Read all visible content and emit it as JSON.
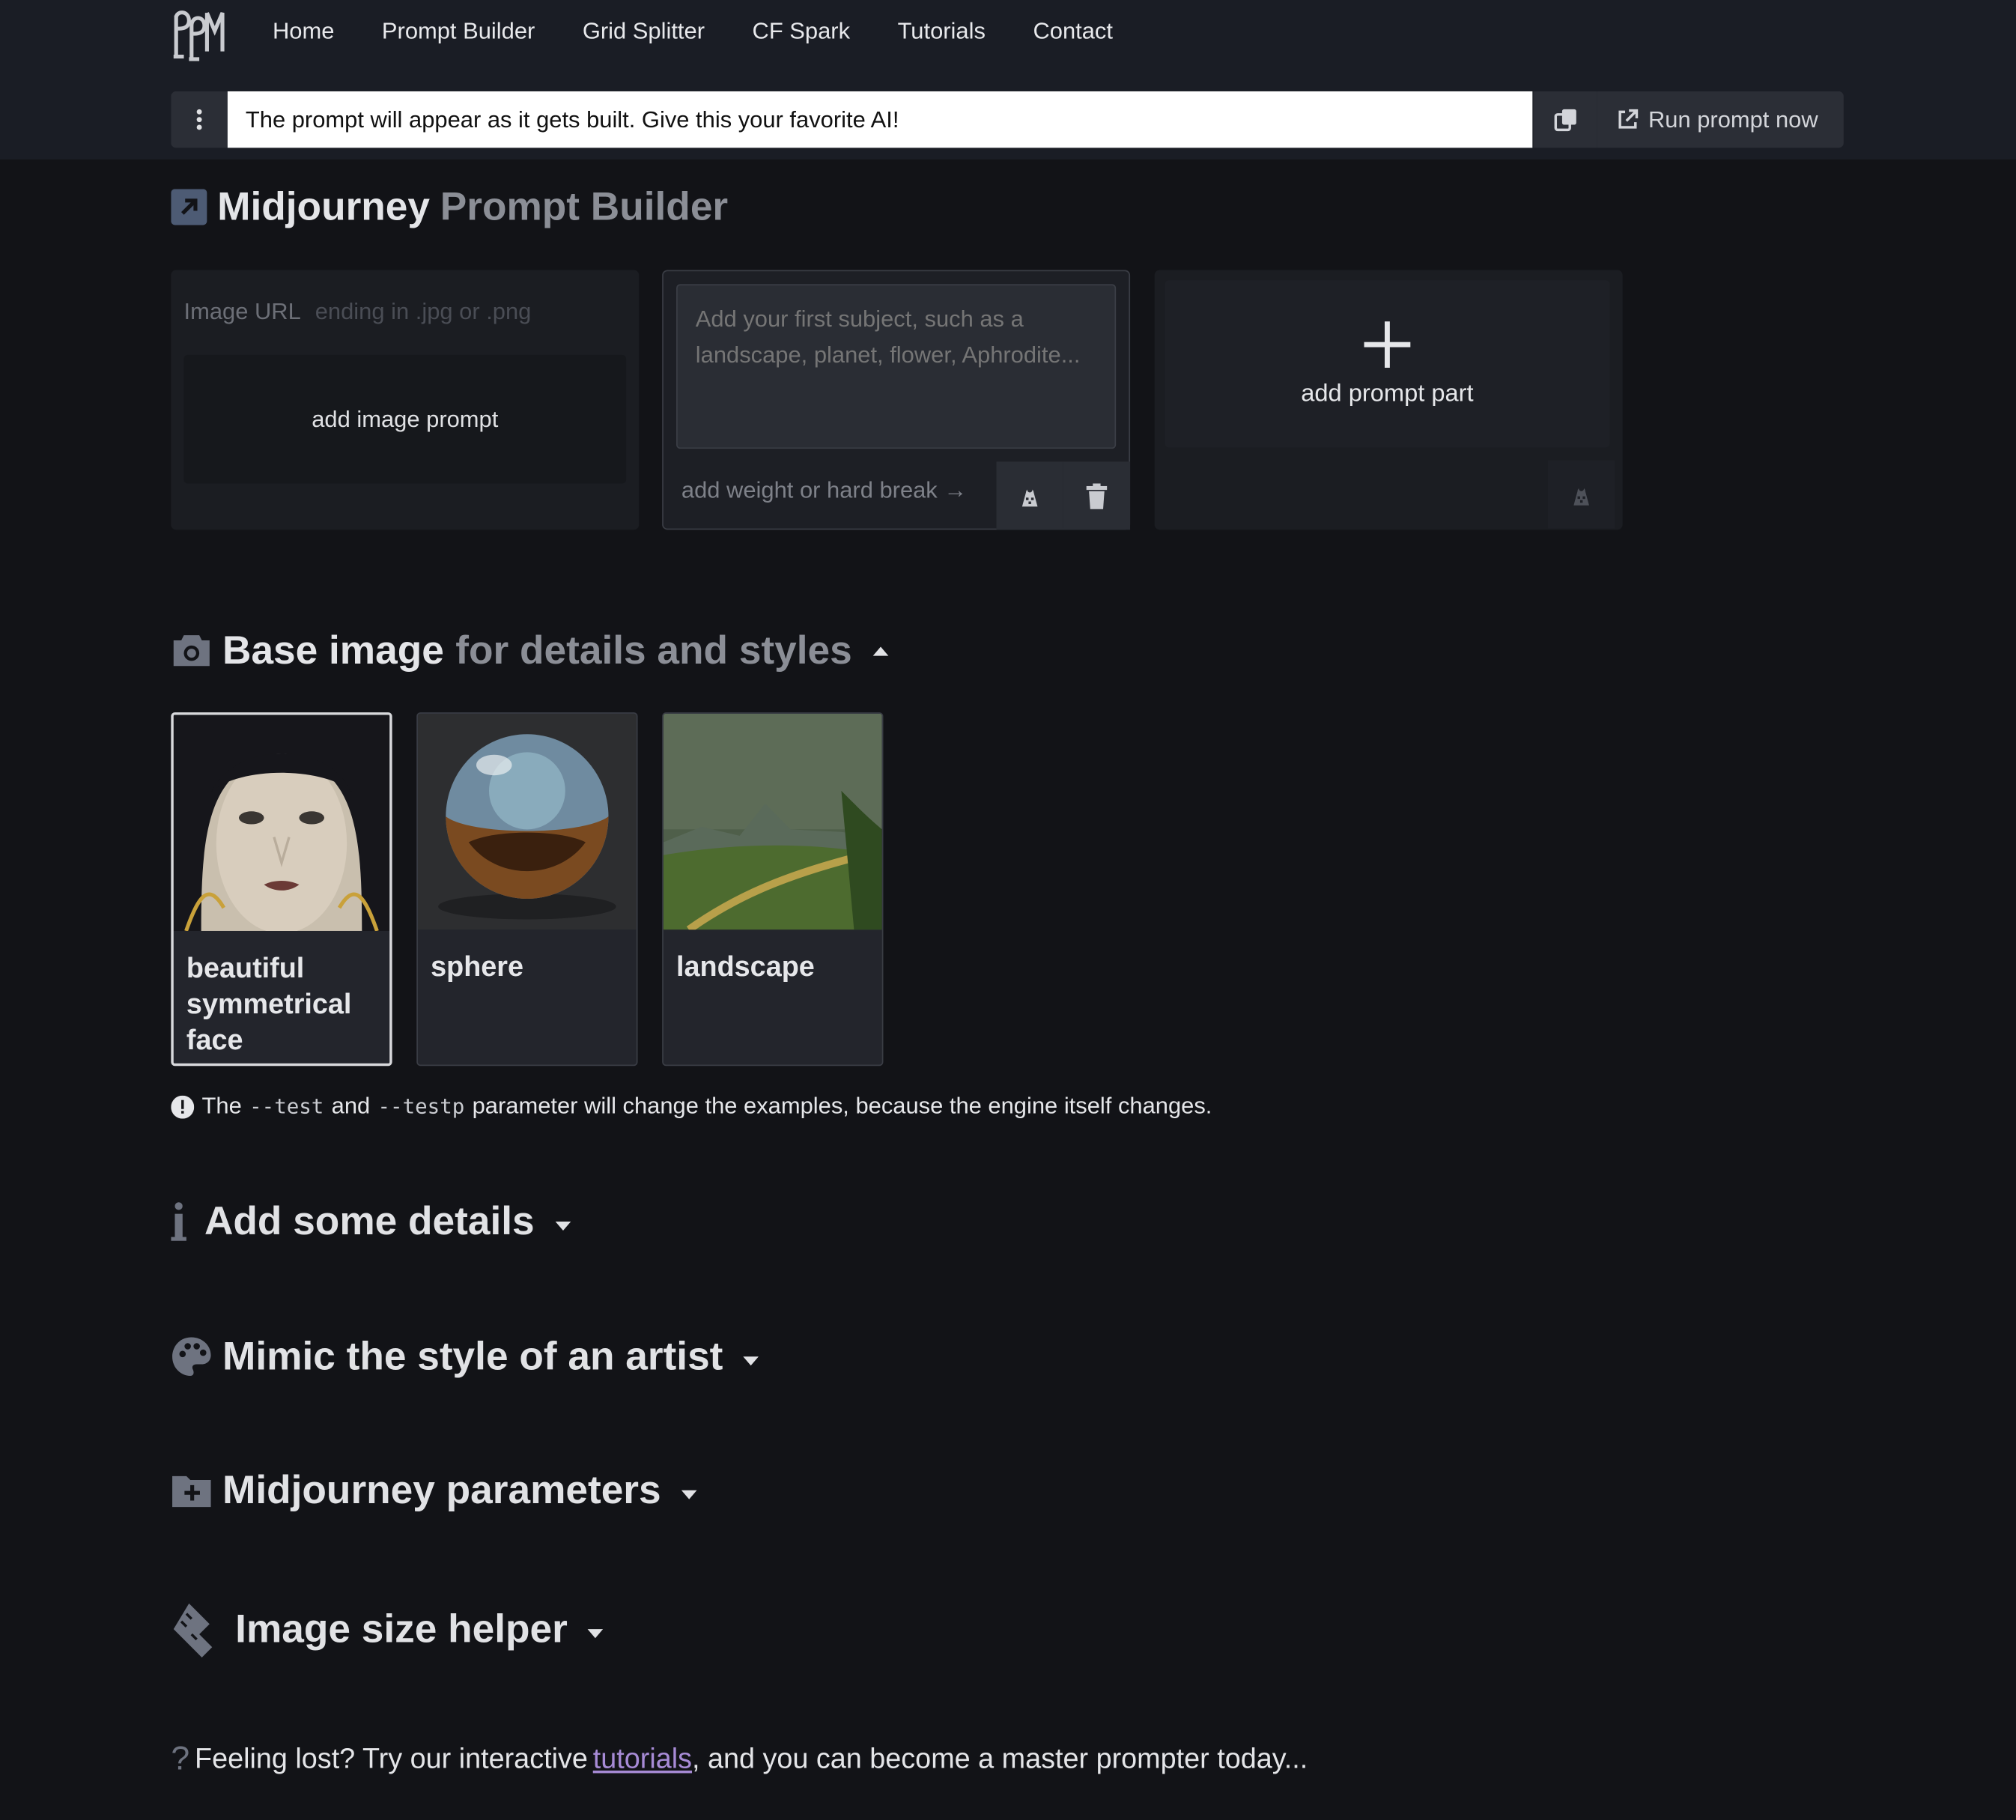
{
  "nav": {
    "items": [
      "Home",
      "Prompt Builder",
      "Grid Splitter",
      "CF Spark",
      "Tutorials",
      "Contact"
    ]
  },
  "prompt_bar": {
    "value": "The prompt will appear as it gets built. Give this your favorite AI!",
    "run_label": "Run prompt now"
  },
  "header": {
    "title_strong": "Midjourney",
    "title_muted": "Prompt Builder"
  },
  "image_prompt": {
    "url_label": "Image URL",
    "url_placeholder": "ending in .jpg or .png",
    "add_label": "add image prompt"
  },
  "subject": {
    "placeholder": "Add your first subject, such as a landscape, planet, flower, Aphrodite...",
    "weight_label": "add weight or hard break →"
  },
  "add_part": {
    "label": "add prompt part",
    "plus": "+"
  },
  "base_image": {
    "title_strong": "Base image",
    "title_muted": "for details and styles",
    "tiles": [
      {
        "label": "beautiful symmetrical face",
        "selected": true
      },
      {
        "label": "sphere",
        "selected": false
      },
      {
        "label": "landscape",
        "selected": false
      }
    ],
    "note_pre": "The",
    "note_code1": "--test",
    "note_mid": "and",
    "note_code2": "--testp",
    "note_post": "parameter will change the examples, because the engine itself changes."
  },
  "sections": {
    "details": "Add some details",
    "artist": "Mimic the style of an artist",
    "params": "Midjourney parameters",
    "size": "Image size helper"
  },
  "footer": {
    "pre": "Feeling lost? Try our interactive",
    "link": "tutorials",
    "post": ", and you can become a master prompter today..."
  },
  "colors": {
    "topbar": "#1a1d25",
    "background": "#121317",
    "link": "#a78bd6"
  }
}
